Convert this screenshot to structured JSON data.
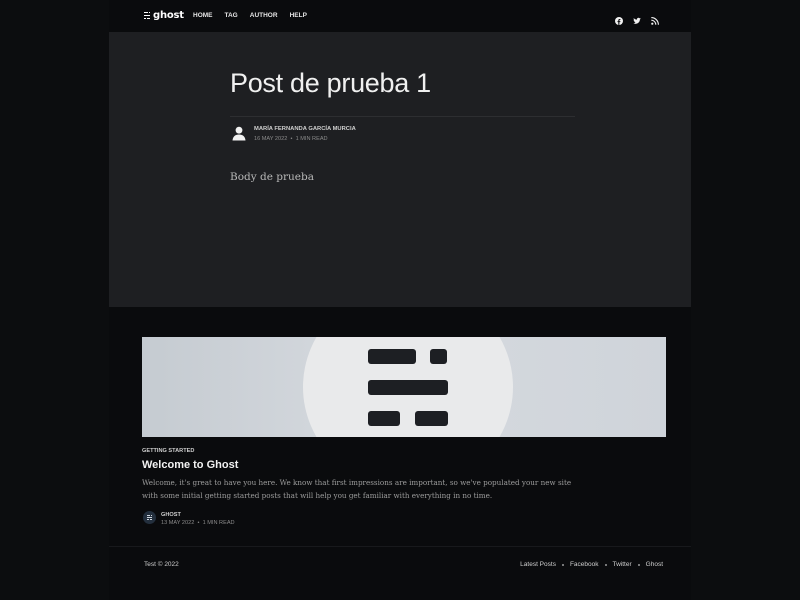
{
  "header": {
    "logo_text": "ghost",
    "nav": [
      "HOME",
      "TAG",
      "AUTHOR",
      "HELP"
    ],
    "social_icons": [
      "facebook-icon",
      "twitter-icon",
      "rss-icon"
    ]
  },
  "post": {
    "title": "Post de prueba 1",
    "author": "MARÍA FERNANDA GARCÍA MURCIA",
    "date": "16 MAY 2022",
    "reading_time": "1 MIN READ",
    "body": "Body de prueba"
  },
  "related": {
    "tag": "GETTING STARTED",
    "title": "Welcome to Ghost",
    "excerpt": "Welcome, it's great to have you here. We know that first impressions are important, so we've populated your new site with some initial getting started posts that will help you get familiar with everything in no time.",
    "author": "GHOST",
    "date": "13 MAY 2022",
    "reading_time": "1 MIN READ"
  },
  "footer": {
    "copyright": "Test © 2022",
    "links": [
      "Latest Posts",
      "Facebook",
      "Twitter",
      "Ghost"
    ]
  },
  "colors": {
    "background": "#0a0b0d",
    "post_header_bg": "#1e1f22",
    "text": "#e8e8e8"
  }
}
